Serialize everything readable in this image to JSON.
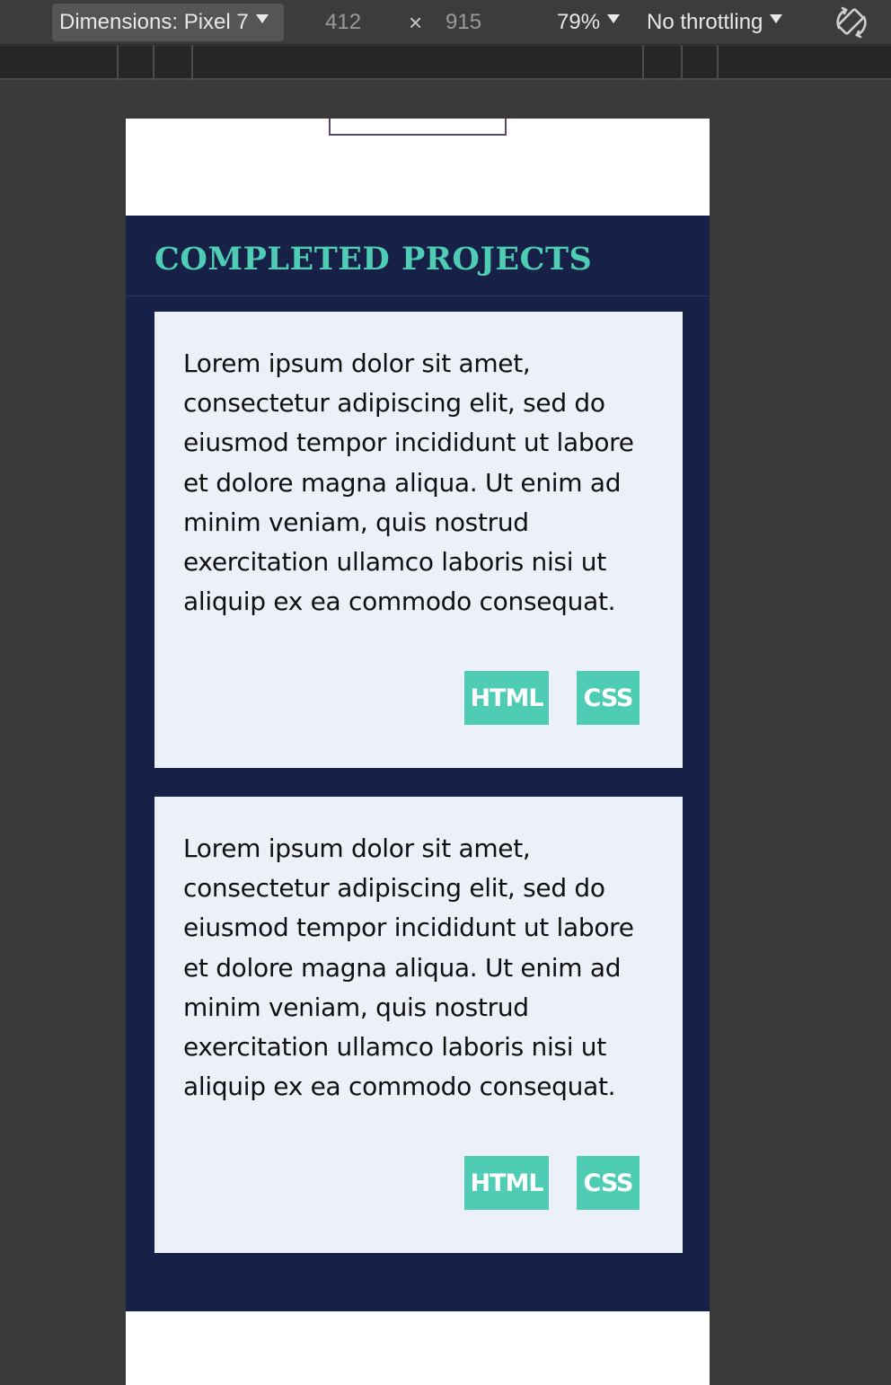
{
  "devtools": {
    "device_label": "Dimensions: Pixel 7",
    "width": "412",
    "times": "×",
    "height": "915",
    "zoom": "79%",
    "throttling": "No throttling",
    "rotate_icon": "rotate-icon"
  },
  "colors": {
    "section_bg": "#172047",
    "accent": "#4ecdb4",
    "card_bg": "#ecf0f8"
  },
  "projects": {
    "title": "COMPLETED PROJECTS",
    "cards": [
      {
        "text": "Lorem ipsum dolor sit amet, consectetur adipiscing elit, sed do eiusmod tempor incididunt ut labore et dolore magna aliqua. Ut enim ad minim veniam, quis nostrud exercitation ullamco laboris nisi ut aliquip ex ea commodo consequat.",
        "tags": [
          "HTML",
          "CSS"
        ]
      },
      {
        "text": "Lorem ipsum dolor sit amet, consectetur adipiscing elit, sed do eiusmod tempor incididunt ut labore et dolore magna aliqua. Ut enim ad minim veniam, quis nostrud exercitation ullamco laboris nisi ut aliquip ex ea commodo consequat.",
        "tags": [
          "HTML",
          "CSS"
        ]
      }
    ]
  }
}
